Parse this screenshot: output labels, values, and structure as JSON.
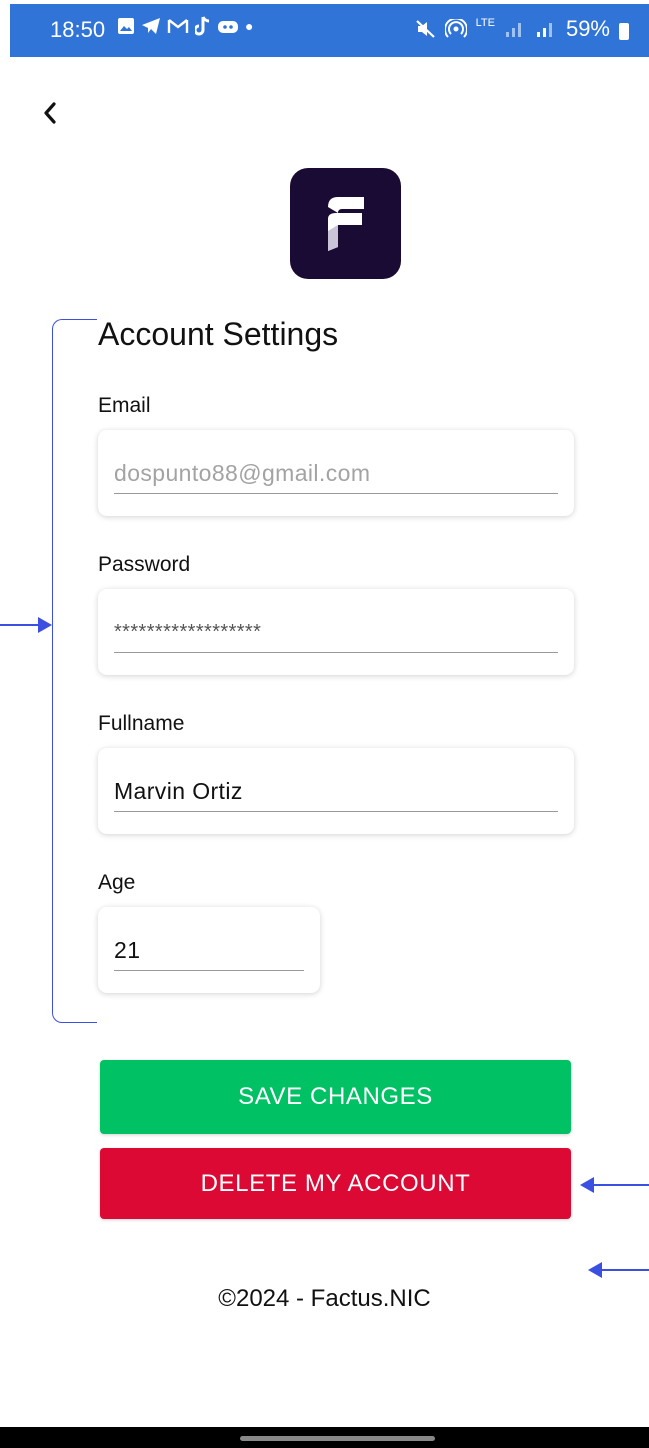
{
  "status_bar": {
    "time": "18:50",
    "battery": "59%",
    "network": "LTE",
    "bg_color": "#2f74d6"
  },
  "header": {
    "back_icon": "chevron-left-icon"
  },
  "logo": {
    "bg_color": "#1a0b34",
    "icon": "factus-logo"
  },
  "form": {
    "title": "Account Settings",
    "fields": {
      "email": {
        "label": "Email",
        "placeholder": "dospunto88@gmail.com"
      },
      "password": {
        "label": "Password",
        "value": "******************"
      },
      "fullname": {
        "label": "Fullname",
        "value": "Marvin Ortiz"
      },
      "age": {
        "label": "Age",
        "value": "21"
      }
    }
  },
  "buttons": {
    "save": {
      "label": "SAVE CHANGES",
      "color": "#00c265"
    },
    "delete": {
      "label": "DELETE MY ACCOUNT",
      "color": "#dc0935"
    }
  },
  "footer": {
    "text": "©2024 - Factus.NIC"
  },
  "annotation_color": "#3b4fe0"
}
